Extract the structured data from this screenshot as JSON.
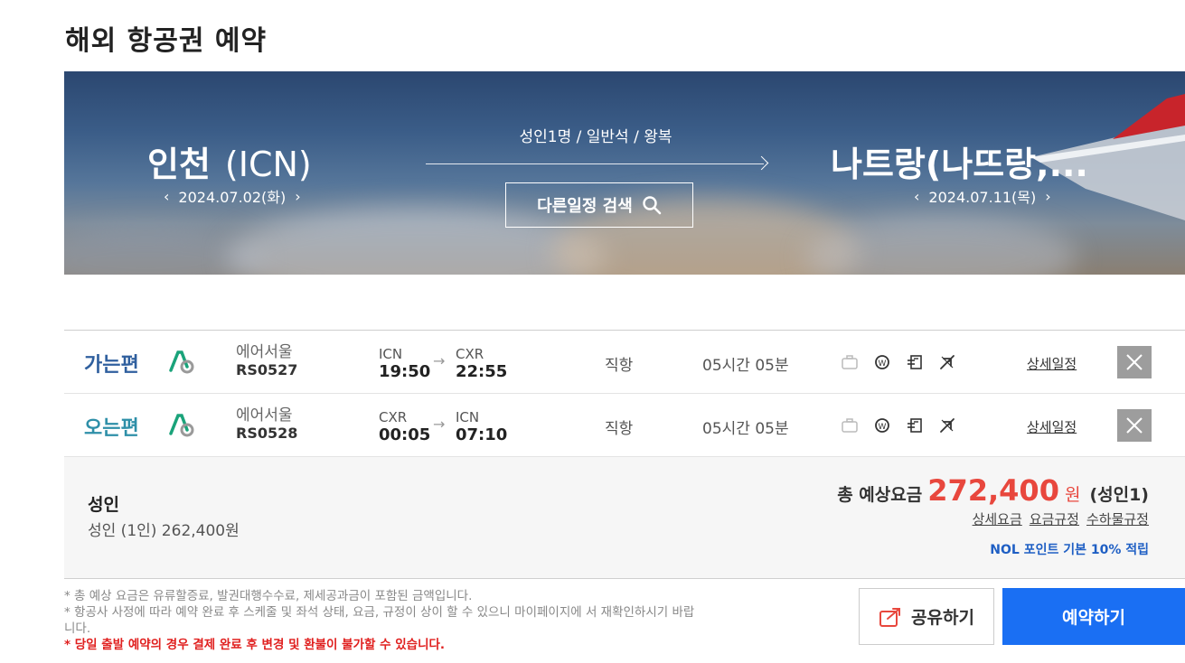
{
  "page_title": "해외 항공권 예약",
  "search": {
    "from_city": "인천",
    "from_code": "(ICN)",
    "from_date": "2024.07.02(화)",
    "to_city": "나트랑(나뜨랑,...",
    "to_date": "2024.07.11(목)",
    "pax_info": "성인1명 / 일반석 / 왕복",
    "other_schedule_label": "다른일정 검색"
  },
  "flights": [
    {
      "leg": "가는편",
      "airline": "에어서울",
      "flight_no": "RS0527",
      "dep_airport": "ICN",
      "dep_time": "19:50",
      "arr_airport": "CXR",
      "arr_time": "22:55",
      "stops": "직항",
      "duration": "05시간 05분",
      "detail_label": "상세일정"
    },
    {
      "leg": "오는편",
      "airline": "에어서울",
      "flight_no": "RS0528",
      "dep_airport": "CXR",
      "dep_time": "00:05",
      "arr_airport": "ICN",
      "arr_time": "07:10",
      "stops": "직항",
      "duration": "05시간 05분",
      "detail_label": "상세일정"
    }
  ],
  "summary": {
    "title": "성인",
    "detail": "성인 (1인)  262,400원",
    "total_label": "총 예상요금",
    "total_amount": "272,400",
    "total_unit": "원",
    "total_pax": "(성인1)",
    "link_fare_detail": "상세요금",
    "link_fare_rules": "요금규정",
    "link_baggage_rules": "수하물규정",
    "points": "NOL 포인트 기본 10% 적립"
  },
  "notes": {
    "line1": "* 총 예상 요금은 유류할증료, 발권대행수수료, 제세공과금이 포함된 금액입니다.",
    "line2": "* 항공사 사정에 따라 예약 완료 후 스케줄 및 좌석 상태, 요금, 규정이 상이 할 수 있으니 마이페이지에 서 재확인하시기 바랍니다.",
    "warning": "* 당일 출발 예약의 경우 결제 완료 후 변경 및 환불이 불가할 수 있습니다."
  },
  "buttons": {
    "share": "공유하기",
    "book": "예약하기"
  },
  "colors": {
    "accent_blue": "#1a6ff3",
    "price_red": "#e8473d",
    "go_leg": "#2f5f9e",
    "return_leg": "#2e8fa8",
    "airline_green": "#1aa37a"
  },
  "icons": [
    "baggage-icon",
    "fare-icon",
    "document-icon",
    "flight-icon"
  ]
}
